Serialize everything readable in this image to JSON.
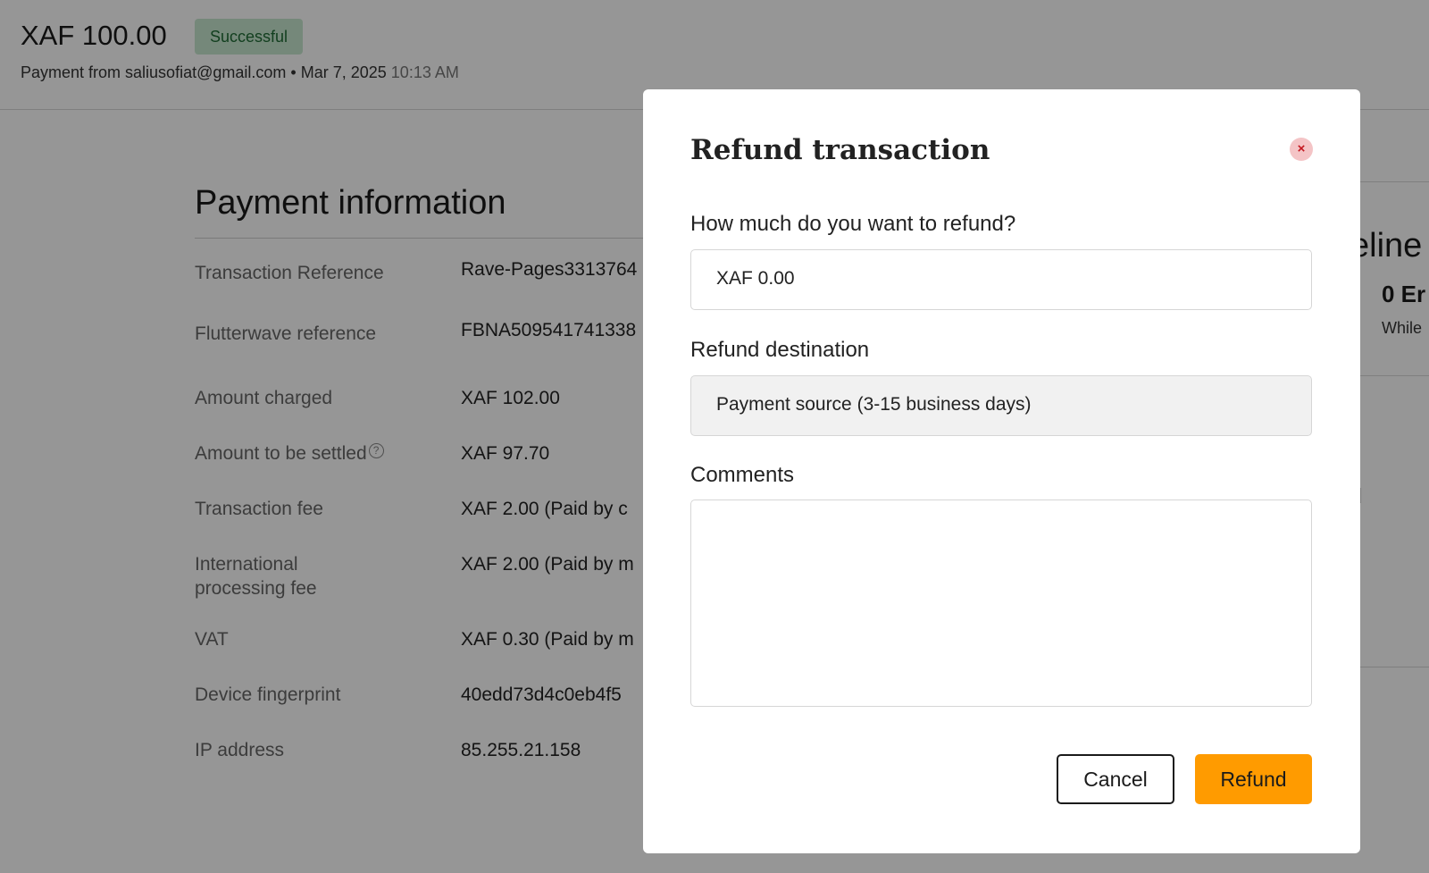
{
  "header": {
    "amount": "XAF 100.00",
    "status_badge": "Successful",
    "payment_from": "Payment from saliusofiat@gmail.com",
    "separator": "•",
    "date": "Mar 7, 2025",
    "time": "10:13 AM"
  },
  "payment_info": {
    "title": "Payment information",
    "rows": [
      {
        "label": "Transaction Reference",
        "value": "Rave-Pages3313764"
      },
      {
        "label": "Flutterwave reference",
        "value": "FBNA509541741338"
      },
      {
        "label": "Amount charged",
        "value": "XAF 102.00"
      },
      {
        "label": "Amount to be settled",
        "value": "XAF 97.70"
      },
      {
        "label": "Transaction fee",
        "value": "XAF 2.00 (Paid by c"
      },
      {
        "label": "International processing fee",
        "value": "XAF 2.00 (Paid by m"
      },
      {
        "label": "VAT",
        "value": "XAF 0.30 (Paid by m"
      },
      {
        "label": "Device fingerprint",
        "value": "40edd73d4c0eb4f5"
      },
      {
        "label": "IP address",
        "value": "85.255.21.158"
      }
    ],
    "help_icon_glyph": "?"
  },
  "right_panel": {
    "heading_fragment": "eline",
    "count_fragment": "0 Er",
    "desc_fragment": "While",
    "text_fragment": "d"
  },
  "modal": {
    "title": "Refund transaction",
    "close_glyph": "×",
    "amount_label": "How much do you want to refund?",
    "amount_value": "XAF 0.00",
    "destination_label": "Refund destination",
    "destination_value": "Payment source (3-15 business days)",
    "comments_label": "Comments",
    "comments_value": "",
    "cancel_label": "Cancel",
    "refund_label": "Refund"
  },
  "colors": {
    "accent": "#ff9b00",
    "badge_bg": "#c7e8cf",
    "badge_text": "#1f6b35",
    "close_bg": "#f4c4c6",
    "close_icon": "#c41820"
  }
}
